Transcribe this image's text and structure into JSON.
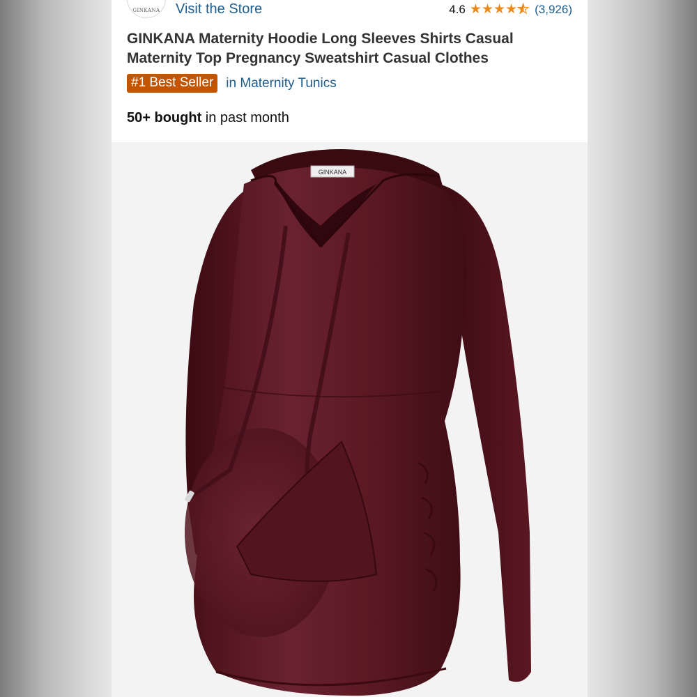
{
  "store": {
    "logo_text": "GINKANA",
    "visit_label": "Visit the Store"
  },
  "rating": {
    "value": "4.6",
    "stars": 4.6,
    "count": "(3,926)",
    "star_color": "#ea8a1a"
  },
  "product": {
    "title": "GINKANA Maternity Hoodie Long Sleeves Shirts Casual Maternity Top Pregnancy Sweatshirt Casual Clothes",
    "badge": "#1 Best Seller",
    "badge_color": "#c45500",
    "category": "in Maternity Tunics",
    "bought_count": "50+ bought",
    "bought_suffix": " in past month",
    "image_label": "GINKANA",
    "garment_color": "#5e1a24"
  }
}
